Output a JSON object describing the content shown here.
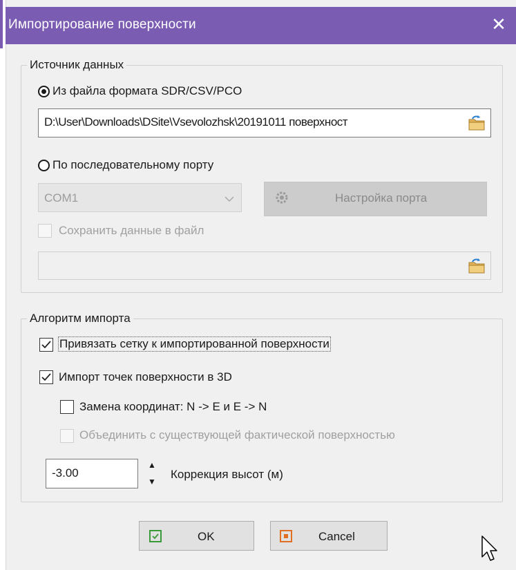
{
  "window": {
    "title": "Импортирование поверхности",
    "close_glyph": "✕",
    "accent": "#7a5db3"
  },
  "source_group": {
    "legend": "Источник данных",
    "file_option": {
      "label": "Из файла формата SDR/CSV/PCO",
      "checked": true
    },
    "file_path": "D:\\User\\Downloads\\DSite\\Vsevolozhsk\\20191011 поверхност",
    "port_option": {
      "label": "По последовательному порту",
      "checked": false
    },
    "port_select": {
      "value": "COM1"
    },
    "port_settings_button": "Настройка порта",
    "save_to_file": {
      "label": "Сохранить данные в файл",
      "checked": false
    },
    "save_path": ""
  },
  "algorithm_group": {
    "legend": "Алгоритм импорта",
    "bind_grid": {
      "label": "Привязать сетку к импортированной поверхности",
      "checked": true
    },
    "import_3d": {
      "label": "Импорт точек поверхности в 3D",
      "checked": true
    },
    "swap_coords": {
      "label": "Замена координат: N -> E и E -> N",
      "checked": false
    },
    "merge_actual": {
      "label": "Объединить с существующей фактической поверхностью",
      "checked": false
    },
    "height_correction": {
      "value": "-3.00",
      "label": "Коррекция высот (м)"
    }
  },
  "buttons": {
    "ok": "OK",
    "cancel": "Cancel"
  },
  "icons": {
    "folder": "folder-open-icon",
    "gear": "gear-icon",
    "ok": "check-square-icon",
    "cancel": "x-square-icon"
  },
  "colors": {
    "ok_icon": "#3a9a3a",
    "cancel_icon": "#e07020",
    "disabled_text": "#a0a0a0"
  }
}
